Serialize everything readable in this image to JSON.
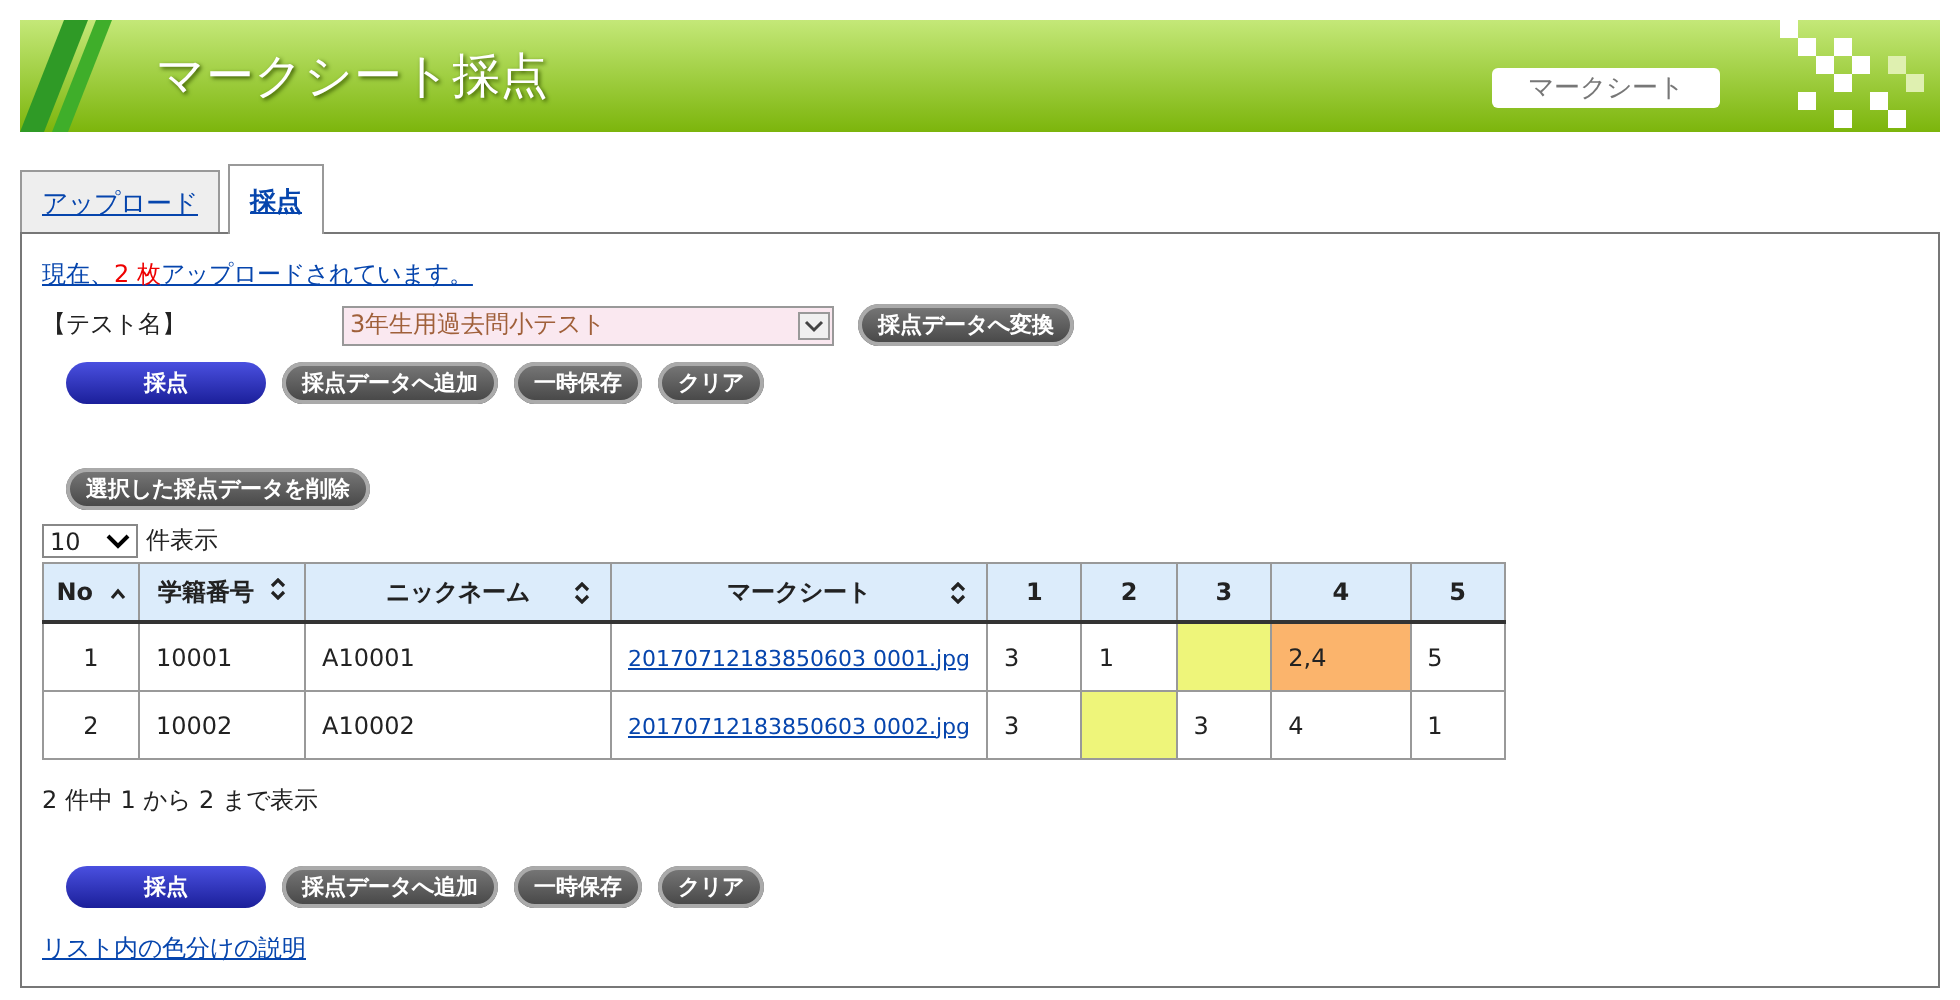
{
  "header": {
    "title": "マークシート採点",
    "badge": "マークシート"
  },
  "tabs": [
    {
      "label": "アップロード",
      "selected": false
    },
    {
      "label": "採点",
      "selected": true
    }
  ],
  "notice": {
    "before": "現在、",
    "count": "2 枚",
    "after": "アップロードされています。"
  },
  "test_select": {
    "label": "【テスト名】",
    "value": "3年生用過去問小テスト",
    "button": "採点データへ変換"
  },
  "actions_top": [
    {
      "label": "採点",
      "kind": "primary"
    },
    {
      "label": "採点データへ追加",
      "kind": "secondary"
    },
    {
      "label": "一時保存",
      "kind": "secondary"
    },
    {
      "label": "クリア",
      "kind": "secondary"
    }
  ],
  "delete_button": "選択した採点データを削除",
  "page_size": {
    "value": "10",
    "suffix": "件表示"
  },
  "table": {
    "columns": [
      {
        "label": "No",
        "sorted": true
      },
      {
        "label": "学籍番号",
        "sorted": false
      },
      {
        "label": "ニックネーム",
        "sorted": false
      },
      {
        "label": "マークシート",
        "sorted": false
      },
      {
        "label": "1"
      },
      {
        "label": "2"
      },
      {
        "label": "3"
      },
      {
        "label": "4"
      },
      {
        "label": "5"
      }
    ],
    "rows": [
      {
        "no": "1",
        "id": "10001",
        "nickname": "A10001",
        "file": "20170712183850603 0001.jpg",
        "answers": [
          {
            "text": "3"
          },
          {
            "text": "1"
          },
          {
            "color": "#eef57a"
          },
          {
            "text": "2,4",
            "color": "#fbb46c"
          },
          {
            "text": "5"
          }
        ]
      },
      {
        "no": "2",
        "id": "10002",
        "nickname": "A10002",
        "file": "20170712183850603 0002.jpg",
        "answers": [
          {
            "text": "3"
          },
          {
            "color": "#eef57a"
          },
          {
            "text": "3"
          },
          {
            "text": "4"
          },
          {
            "text": "1"
          }
        ]
      }
    ]
  },
  "summary": "2 件中 1 から 2 まで表示",
  "actions_bottom": [
    {
      "label": "採点",
      "kind": "primary"
    },
    {
      "label": "採点データへ追加",
      "kind": "secondary"
    },
    {
      "label": "一時保存",
      "kind": "secondary"
    },
    {
      "label": "クリア",
      "kind": "secondary"
    }
  ],
  "legend_link": "リスト内の色分けの説明"
}
